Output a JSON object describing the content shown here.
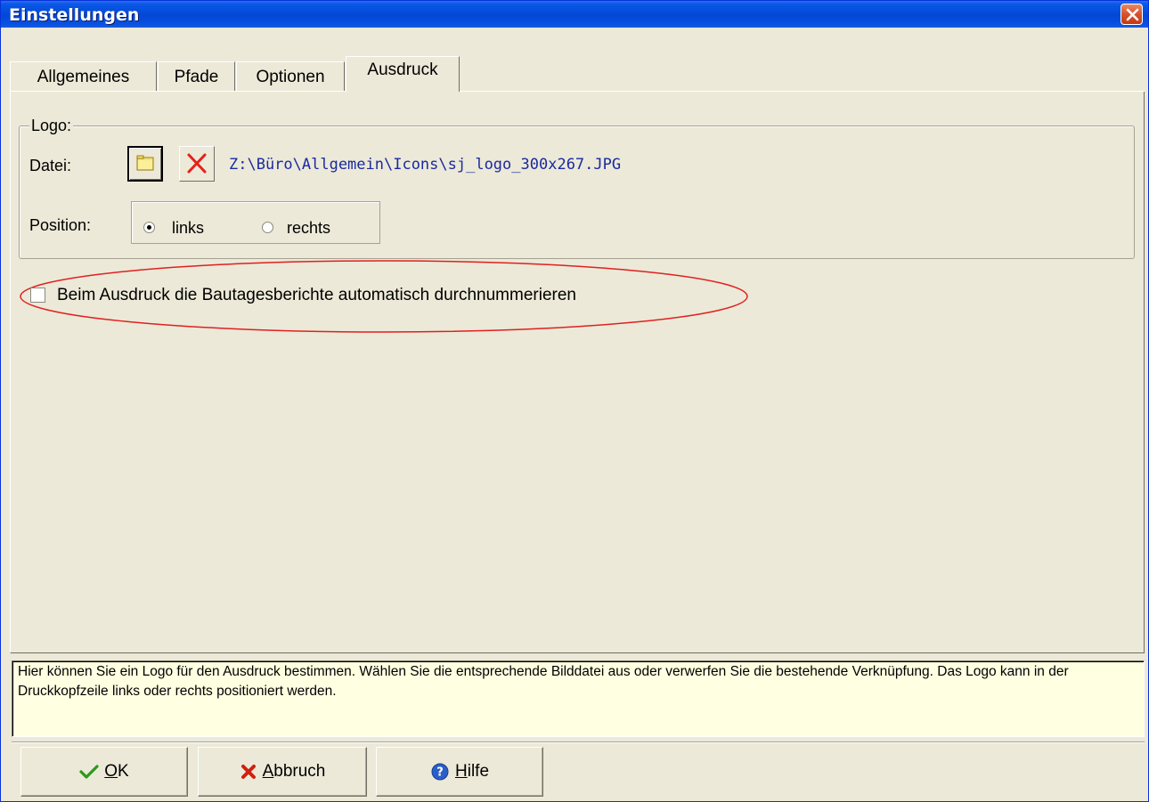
{
  "window": {
    "title": "Einstellungen",
    "close_icon": "close-icon"
  },
  "tabs": [
    {
      "label": "Allgemeines",
      "active": false
    },
    {
      "label": "Pfade",
      "active": false
    },
    {
      "label": "Optionen",
      "active": false
    },
    {
      "label": "Ausdruck",
      "active": true
    }
  ],
  "logo": {
    "group_label": "Logo:",
    "file_label": "Datei:",
    "browse_icon": "folder-icon",
    "delete_icon": "delete-x-icon",
    "file_path": "Z:\\Büro\\Allgemein\\Icons\\sj_logo_300x267.JPG",
    "position_label": "Position:",
    "position_options": [
      {
        "label": "links",
        "selected": true
      },
      {
        "label": "rechts",
        "selected": false
      }
    ]
  },
  "auto_number": {
    "label": "Beim Ausdruck die Bautagesberichte automatisch durchnummerieren",
    "checked": false,
    "highlight_color": "#e02020"
  },
  "help_text": "Hier können Sie ein Logo für den Ausdruck bestimmen. Wählen Sie die entsprechende Bilddatei aus oder verwerfen Sie die bestehende Verknüpfung. Das Logo kann in der Druckkopfzeile links oder rechts positioniert werden.",
  "buttons": {
    "ok": {
      "accel": "O",
      "rest": "K",
      "icon": "checkmark-icon",
      "color": "#2a9a1a"
    },
    "cancel": {
      "accel": "A",
      "rest": "bbruch",
      "icon": "cancel-x-icon",
      "color": "#d02010"
    },
    "help": {
      "accel": "H",
      "rest": "ilfe",
      "icon": "help-icon",
      "color": "#2a5fc8"
    }
  }
}
